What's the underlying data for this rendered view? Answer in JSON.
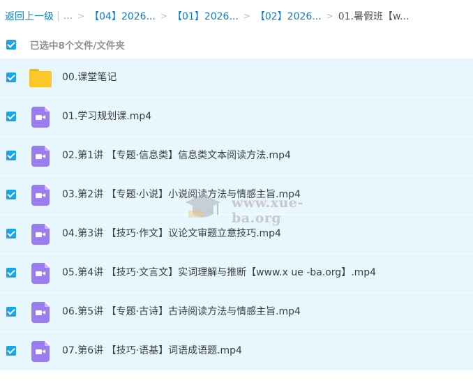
{
  "breadcrumb": {
    "back_label": "返回上一级",
    "pipe": "|",
    "ellipsis": "...",
    "separator": ">",
    "items": [
      "【04】2026...",
      "【01】2026...",
      "【02】2026..."
    ],
    "current": "01.暑假班【w..."
  },
  "selection": {
    "checked": true,
    "count_label": "已选中8个文件/文件夹"
  },
  "files": [
    {
      "name": "00.课堂笔记",
      "type": "folder",
      "checked": true
    },
    {
      "name": "01.学习规划课.mp4",
      "type": "video",
      "checked": true
    },
    {
      "name": "02.第1讲 【专题·信息类】信息类文本阅读方法.mp4",
      "type": "video",
      "checked": true
    },
    {
      "name": "03.第2讲 【专题·小说】小说阅读方法与情感主旨.mp4",
      "type": "video",
      "checked": true
    },
    {
      "name": "04.第3讲 【技巧·作文】议论文审题立意技巧.mp4",
      "type": "video",
      "checked": true
    },
    {
      "name": "05.第4讲 【技巧·文言文】实词理解与推断【www.x ue -ba.org】.mp4",
      "type": "video",
      "checked": true
    },
    {
      "name": "06.第5讲 【专题·古诗】古诗阅读方法与情感主旨.mp4",
      "type": "video",
      "checked": true
    },
    {
      "name": "07.第6讲 【技巧·语基】词语成语题.mp4",
      "type": "video",
      "checked": true
    }
  ],
  "watermark": {
    "text": "www.xue-ba.org",
    "icon": "graduation-cap-icon"
  },
  "colors": {
    "accent": "#1ba3e8",
    "link": "#0a7fd0",
    "row_selected_bg": "#e8f6fd",
    "folder": "#fcc72a",
    "video": "#9a7ef0"
  }
}
